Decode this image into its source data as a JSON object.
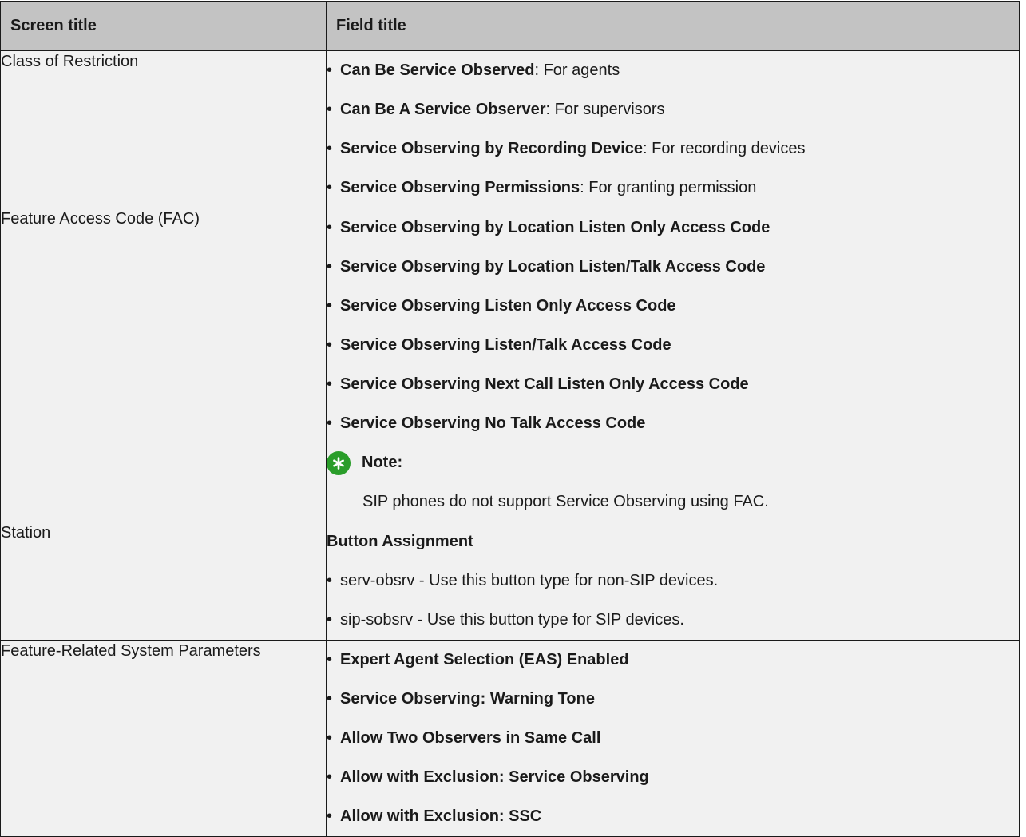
{
  "table": {
    "headers": [
      "Screen title",
      "Field title"
    ],
    "rows": [
      {
        "screen": "Class of Restriction",
        "items": [
          {
            "bold": "Can Be Service Observed",
            "rest": ": For agents"
          },
          {
            "bold": "Can Be A Service Observer",
            "rest": ": For supervisors"
          },
          {
            "bold": "Service Observing by Recording Device",
            "rest": ": For recording devices"
          },
          {
            "bold": "Service Observing Permissions",
            "rest": ": For granting permission"
          }
        ]
      },
      {
        "screen": "Feature Access Code (FAC)",
        "items": [
          {
            "bold": "Service Observing by Location Listen Only Access Code"
          },
          {
            "bold": "Service Observing by Location Listen/Talk Access Code"
          },
          {
            "bold": "Service Observing Listen Only Access Code"
          },
          {
            "bold": "Service Observing Listen/Talk Access Code"
          },
          {
            "bold": "Service Observing Next Call Listen Only Access Code"
          },
          {
            "bold": "Service Observing No Talk Access Code"
          }
        ],
        "note": {
          "label": "Note:",
          "text": "SIP phones do not support Service Observing using FAC.",
          "icon": "asterisk-note-icon",
          "icon_color": "#2a9d2a"
        }
      },
      {
        "screen": "Station",
        "heading": "Button Assignment",
        "items": [
          {
            "rest": "serv-obsrv - Use this button type for non-SIP devices."
          },
          {
            "rest": "sip-sobsrv - Use this button type for SIP devices."
          }
        ]
      },
      {
        "screen": "Feature-Related System Parameters",
        "items": [
          {
            "bold": "Expert Agent Selection (EAS) Enabled"
          },
          {
            "bold": "Service Observing: Warning Tone"
          },
          {
            "bold": "Allow Two Observers in Same Call"
          },
          {
            "bold": "Allow with Exclusion: Service Observing"
          },
          {
            "bold": "Allow with Exclusion: SSC"
          }
        ]
      }
    ]
  },
  "colors": {
    "header_bg": "#c3c3c3",
    "cell_bg": "#f1f1f1",
    "border": "#1a1a1a"
  }
}
